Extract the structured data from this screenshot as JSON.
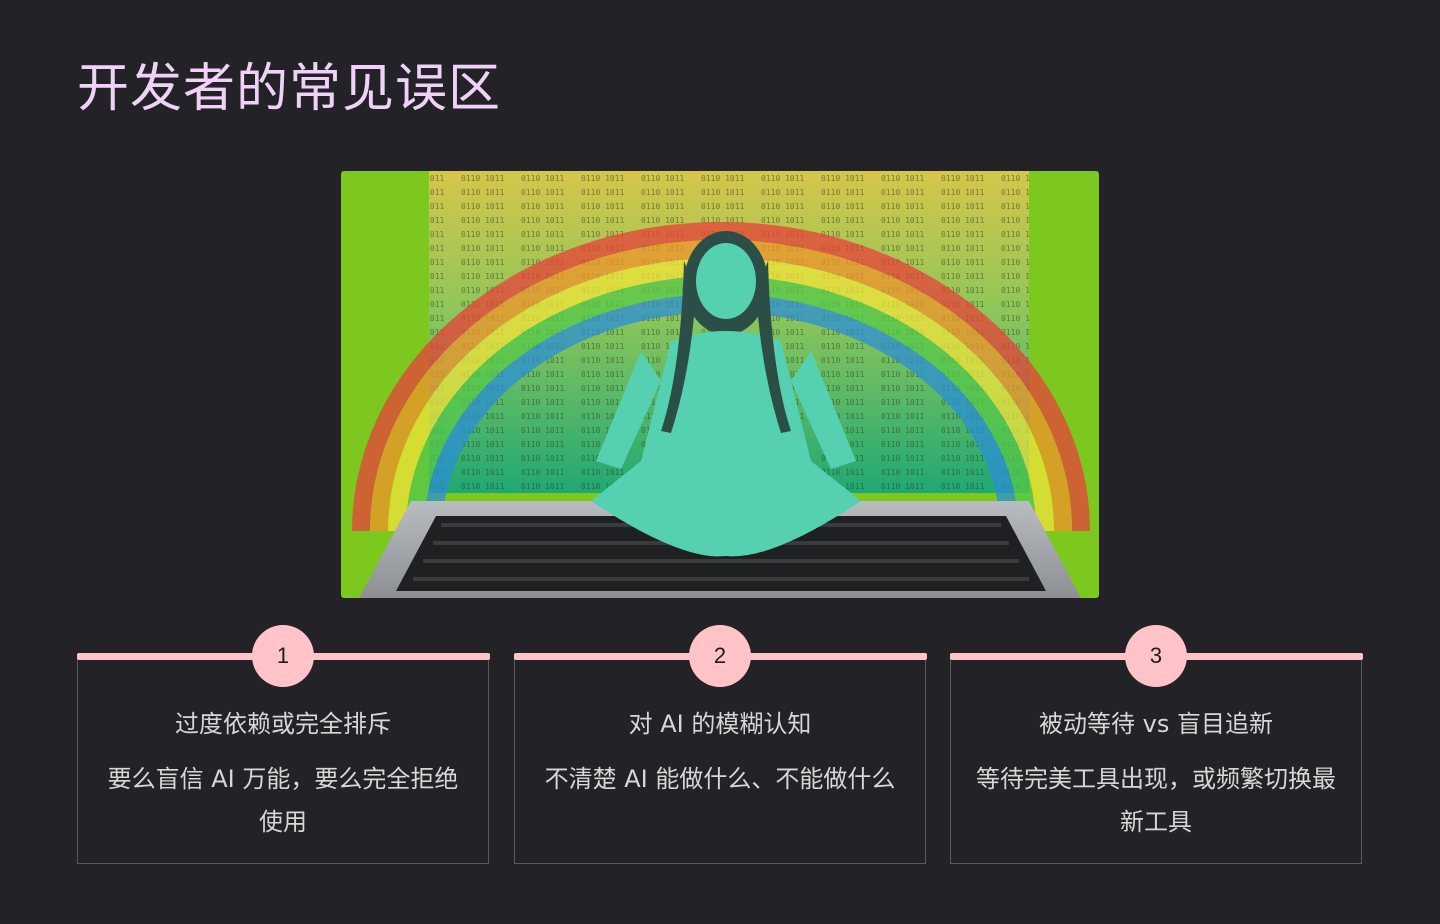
{
  "slide": {
    "title": "开发者的常见误区"
  },
  "hero_image": {
    "description_icon": "meditating-woman-laptop-rainbow-illustration",
    "colors": {
      "green_bg": "#7cc81e",
      "screen_top": "#d6c64a",
      "screen_bottom": "#1fa874",
      "figure": "#55d0b0"
    }
  },
  "colors": {
    "accent": "#ffc3c8",
    "title": "#f0d2f8",
    "background": "#232327",
    "text": "#d7d7da"
  },
  "cards": [
    {
      "number": "1",
      "heading": "过度依赖或完全排斥",
      "desc": "要么盲信 AI 万能，要么完全拒绝使用"
    },
    {
      "number": "2",
      "heading": "对 AI 的模糊认知",
      "desc": "不清楚 AI 能做什么、不能做什么"
    },
    {
      "number": "3",
      "heading": "被动等待 vs 盲目追新",
      "desc": "等待完美工具出现，或频繁切换最新工具"
    }
  ]
}
